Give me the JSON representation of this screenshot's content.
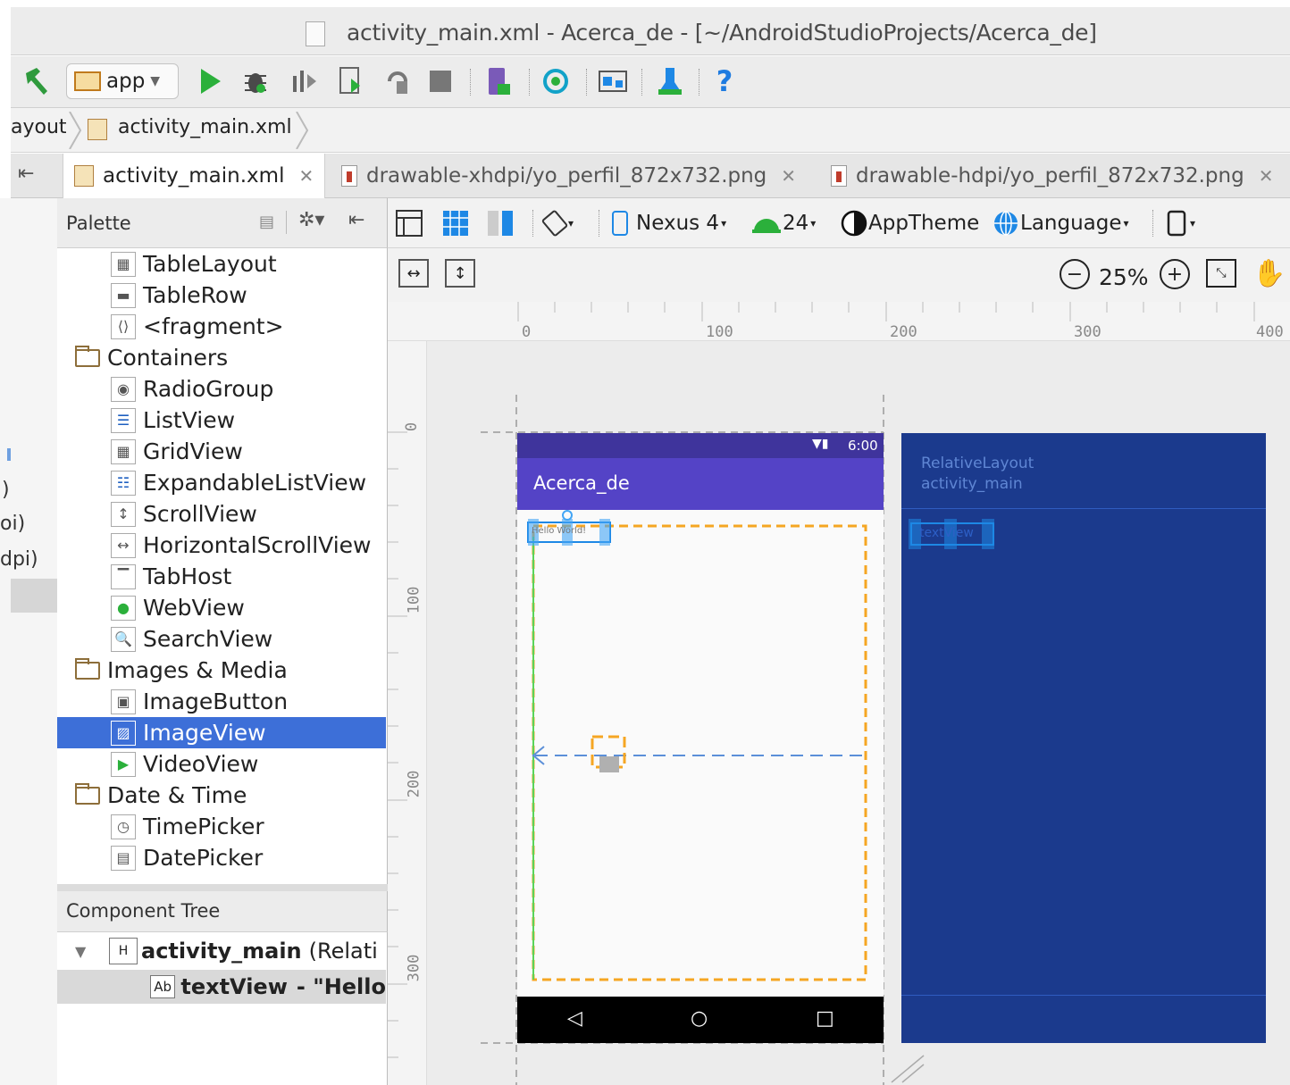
{
  "window": {
    "title": "activity_main.xml - Acerca_de - [~/AndroidStudioProjects/Acerca_de]"
  },
  "toolbar": {
    "run_config": "app",
    "icons": [
      "hammer-icon",
      "run-icon",
      "debug-icon",
      "attach-debugger-icon",
      "apply-changes-icon",
      "rerun-icon",
      "stop-icon",
      "avd-manager-icon",
      "sync-icon",
      "project-structure-icon",
      "sdk-manager-icon",
      "help-icon"
    ]
  },
  "breadcrumb": {
    "items": [
      "ayout",
      "activity_main.xml"
    ]
  },
  "tabs": [
    {
      "label": "activity_main.xml",
      "active": true
    },
    {
      "label": "drawable-xhdpi/yo_perfil_872x732.png",
      "active": false
    },
    {
      "label": "drawable-hdpi/yo_perfil_872x732.png",
      "active": false
    }
  ],
  "left_strip": {
    "texts": [
      ")",
      "oi)",
      "dpi)"
    ]
  },
  "palette": {
    "title": "Palette",
    "items": [
      {
        "label": "TableLayout",
        "kind": "widget",
        "icon": "table-layout-icon"
      },
      {
        "label": "TableRow",
        "kind": "widget",
        "icon": "table-row-icon"
      },
      {
        "label": "<fragment>",
        "kind": "widget",
        "icon": "fragment-icon"
      },
      {
        "label": "Containers",
        "kind": "folder",
        "icon": "folder-icon"
      },
      {
        "label": "RadioGroup",
        "kind": "widget",
        "icon": "radio-group-icon"
      },
      {
        "label": "ListView",
        "kind": "widget",
        "icon": "list-view-icon"
      },
      {
        "label": "GridView",
        "kind": "widget",
        "icon": "grid-view-icon"
      },
      {
        "label": "ExpandableListView",
        "kind": "widget",
        "icon": "expandable-list-icon"
      },
      {
        "label": "ScrollView",
        "kind": "widget",
        "icon": "scroll-view-icon"
      },
      {
        "label": "HorizontalScrollView",
        "kind": "widget",
        "icon": "horizontal-scroll-icon"
      },
      {
        "label": "TabHost",
        "kind": "widget",
        "icon": "tab-host-icon"
      },
      {
        "label": "WebView",
        "kind": "widget",
        "icon": "web-view-icon"
      },
      {
        "label": "SearchView",
        "kind": "widget",
        "icon": "search-view-icon"
      },
      {
        "label": "Images & Media",
        "kind": "folder",
        "icon": "folder-icon"
      },
      {
        "label": "ImageButton",
        "kind": "widget",
        "icon": "image-button-icon"
      },
      {
        "label": "ImageView",
        "kind": "widget",
        "icon": "image-view-icon",
        "selected": true
      },
      {
        "label": "VideoView",
        "kind": "widget",
        "icon": "video-view-icon"
      },
      {
        "label": "Date & Time",
        "kind": "folder",
        "icon": "folder-icon"
      },
      {
        "label": "TimePicker",
        "kind": "widget",
        "icon": "time-picker-icon"
      },
      {
        "label": "DatePicker",
        "kind": "widget",
        "icon": "date-picker-icon"
      }
    ]
  },
  "component_tree": {
    "title": "Component Tree",
    "root": {
      "name": "activity_main",
      "type": "(Relati"
    },
    "child": {
      "name": "textView",
      "text": "- \"Hello"
    }
  },
  "design_toolbar": {
    "device": "Nexus 4",
    "api": "24",
    "theme": "AppTheme",
    "language": "Language",
    "zoom": "25%"
  },
  "rulers": {
    "top": [
      "0",
      "100",
      "200",
      "300",
      "400"
    ],
    "left": [
      "0",
      "100",
      "200",
      "300"
    ]
  },
  "device_preview": {
    "status_time": "6:00",
    "app_title": "Acerca_de",
    "textview_text": "Hello World!"
  },
  "blueprint": {
    "layout_name": "RelativeLayout",
    "layout_id": "activity_main",
    "textview_text": "textView"
  },
  "colors": {
    "primary": "#5443c6",
    "primary_dark": "#3f349c",
    "blueprint": "#1b3a8d",
    "selection": "#3d6fd8"
  }
}
